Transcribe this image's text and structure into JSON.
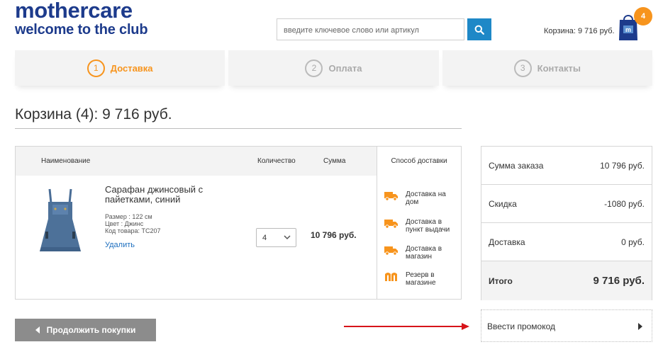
{
  "header": {
    "logo_line1": "mothercare",
    "logo_line2": "welcome to the club",
    "search_placeholder": "введите ключевое слово или артикул",
    "cart_total": "Корзина: 9 716 руб.",
    "cart_count": "4",
    "brand_color": "#1d3b8c",
    "accent_color": "#f7941d",
    "search_button_color": "#1e88c7"
  },
  "steps": [
    {
      "num": "1",
      "label": "Доставка",
      "active": true
    },
    {
      "num": "2",
      "label": "Оплата",
      "active": false
    },
    {
      "num": "3",
      "label": "Контакты",
      "active": false
    }
  ],
  "page_title": "Корзина (4): 9 716 руб.",
  "table": {
    "headers": {
      "name": "Наименование",
      "qty": "Количество",
      "sum": "Сумма",
      "delivery": "Способ доставки"
    },
    "product": {
      "name": "Сарафан джинсовый с пайетками, синий",
      "size": "Размер : 122 см",
      "color": "Цвет : Джинс",
      "code": "Код товара: ТС207",
      "remove_label": "Удалить",
      "quantity": "4",
      "sum": "10 796 руб."
    },
    "delivery_options": [
      {
        "icon": "truck-icon",
        "label": "Доставка на дом"
      },
      {
        "icon": "truck-icon",
        "label": "Доставка в пункт выдачи"
      },
      {
        "icon": "truck-icon",
        "label": "Доставка в магазин"
      },
      {
        "icon": "mothercare-store-icon",
        "label": "Резерв в магазине"
      }
    ]
  },
  "summary": {
    "order_sum_label": "Сумма заказа",
    "order_sum_value": "10 796 руб.",
    "discount_label": "Скидка",
    "discount_value": "-1080 руб.",
    "delivery_label": "Доставка",
    "delivery_value": "0 руб.",
    "total_label": "Итого",
    "total_value": "9 716 руб."
  },
  "promo_label": "Ввести промокод",
  "continue_label": "Продолжить покупки"
}
